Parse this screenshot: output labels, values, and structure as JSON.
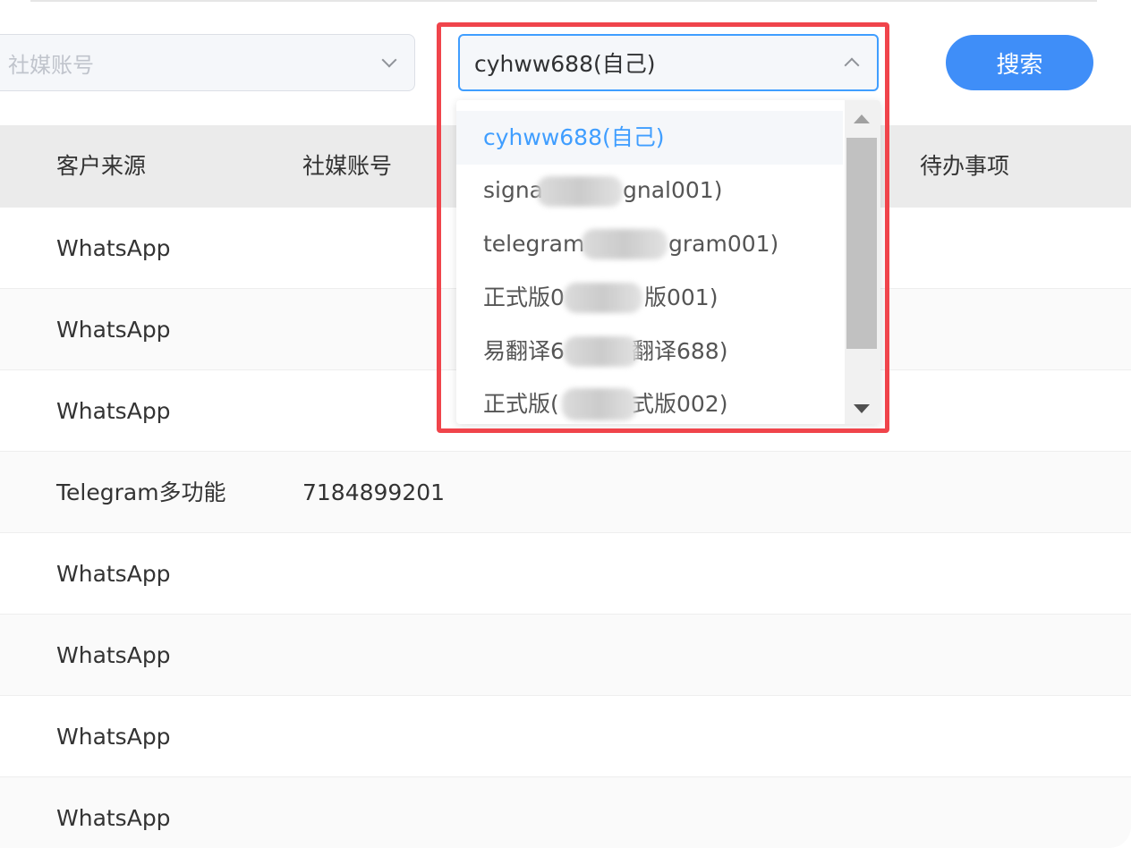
{
  "filters": {
    "social_account_placeholder": "社媒账号",
    "account_select_value": "cyhww688(自己)",
    "search_label": "搜索"
  },
  "table": {
    "headers": [
      "客户来源",
      "社媒账号",
      "待办事项"
    ],
    "rows": [
      {
        "source": "WhatsApp",
        "account": ""
      },
      {
        "source": "WhatsApp",
        "account": ""
      },
      {
        "source": "WhatsApp",
        "account": ""
      },
      {
        "source": "Telegram多功能",
        "account": "7184899201"
      },
      {
        "source": "WhatsApp",
        "account": ""
      },
      {
        "source": "WhatsApp",
        "account": ""
      },
      {
        "source": "WhatsApp",
        "account": ""
      },
      {
        "source": "WhatsApp",
        "account": ""
      }
    ]
  },
  "dropdown": {
    "options": [
      {
        "visible_start": "cyhww688(自己)",
        "visible_end": ""
      },
      {
        "visible_start": "signa",
        "visible_end": "gnal001)"
      },
      {
        "visible_start": "telegram",
        "visible_end": "gram001)"
      },
      {
        "visible_start": "正式版0",
        "visible_end": "版001)"
      },
      {
        "visible_start": "易翻译6",
        "visible_end": "翻译688)"
      },
      {
        "visible_start": "正式版(",
        "visible_end": "式版002)"
      }
    ]
  },
  "colors": {
    "primary": "#409eff",
    "button": "#3f8ef8",
    "highlight_border": "#f0444b"
  }
}
